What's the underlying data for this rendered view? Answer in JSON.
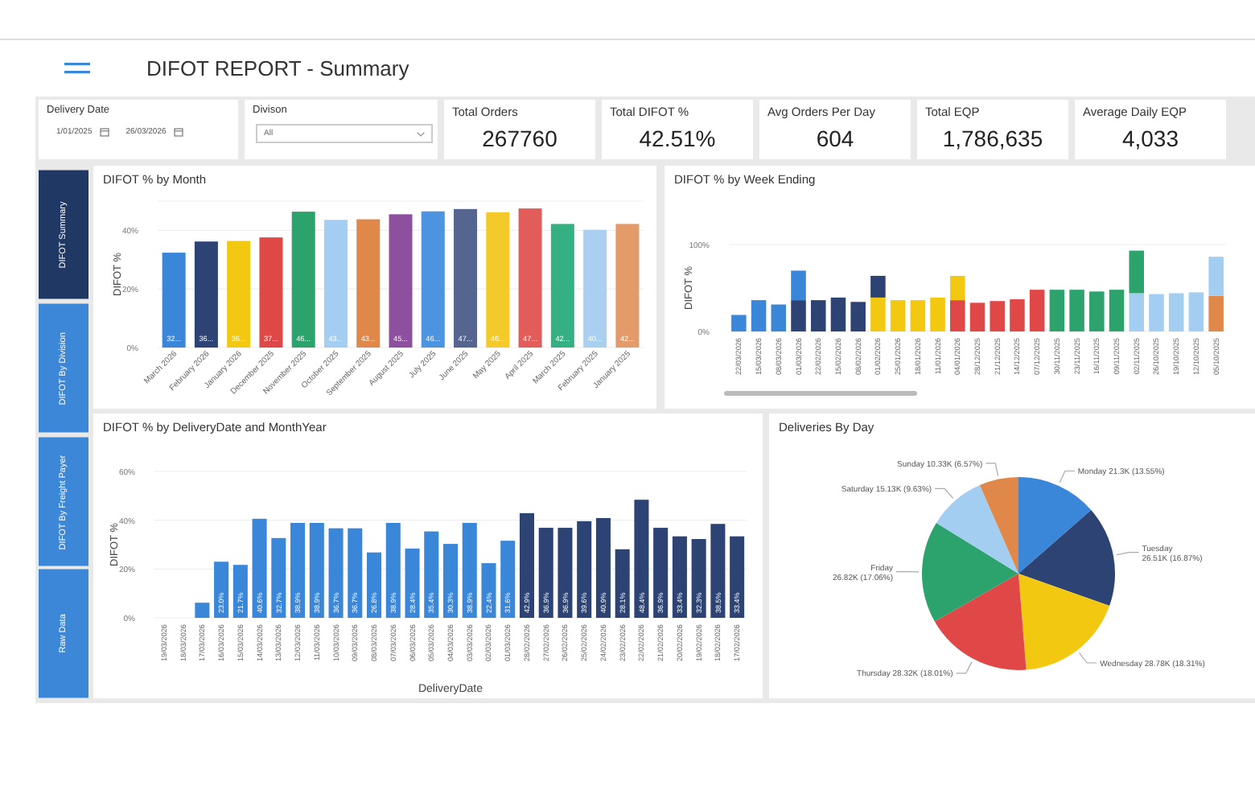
{
  "header": {
    "title": "DIFOT REPORT - Summary"
  },
  "filters": [
    {
      "kind": "date_range",
      "label": "Delivery Date",
      "from": "1/01/2025",
      "to": "26/03/2026"
    },
    {
      "kind": "dropdown",
      "label": "Divison",
      "value": "All"
    }
  ],
  "kpis": [
    {
      "label": "Total Orders",
      "value": "267760"
    },
    {
      "label": "Total DIFOT %",
      "value": "42.51%"
    },
    {
      "label": "Avg Orders Per Day",
      "value": "604"
    },
    {
      "label": "Total EQP",
      "value": "1,786,635"
    },
    {
      "label": "Average Daily EQP",
      "value": "4,033"
    }
  ],
  "tabs": [
    {
      "label": "DIFOT Summary",
      "selected": true
    },
    {
      "label": "DIFOT By Division",
      "selected": false
    },
    {
      "label": "DIFOT By Freight Payer",
      "selected": false
    },
    {
      "label": "Raw Data",
      "selected": false
    }
  ],
  "charts": [
    {
      "chart_data": {
        "type": "bar",
        "title": "DIFOT % by Month",
        "ylabel": "DIFOT %",
        "categories": [
          "March 2026",
          "February 2026",
          "January 2026",
          "December 2025",
          "November 2025",
          "October 2025",
          "September 2025",
          "August 2025",
          "July 2025",
          "June 2025",
          "May 2025",
          "April 2025",
          "March 2025",
          "February 2025",
          "January 2025"
        ],
        "series": [
          {
            "colors": [
              "#3a86d8",
              "#2d4373",
              "#f2c811",
              "#e04848",
              "#2ca36d",
              "#a4cdf2",
              "#e0874a",
              "#8e4f9f",
              "#4c94e0",
              "#56658f",
              "#f3ca2a",
              "#e25c5a",
              "#35b083",
              "#a9d0f0",
              "#e49b69"
            ],
            "values": [
              32.4,
              36.2,
              36.4,
              37.6,
              46.4,
              43.6,
              43.8,
              45.5,
              46.5,
              47.3,
              46.2,
              47.5,
              42.2,
              40.2,
              42.2
            ]
          }
        ],
        "ylim": [
          0,
          50
        ],
        "yticks": [
          {
            "value": 0,
            "label": "0%"
          },
          {
            "value": 20,
            "label": "20%"
          },
          {
            "value": 40,
            "label": "40%"
          }
        ],
        "value_labels": [
          "32...",
          "36...",
          "36...",
          "37...",
          "46...",
          "43...",
          "43...",
          "45...",
          "46...",
          "47...",
          "46...",
          "47...",
          "42...",
          "40...",
          "42..."
        ]
      }
    },
    {
      "chart_data": {
        "type": "bar",
        "title": "DIFOT % by Week Ending",
        "ylabel": "DIFOT %",
        "stacked": true,
        "categories": [
          "22/03/2026",
          "15/03/2026",
          "08/03/2026",
          "01/03/2026",
          "22/02/2026",
          "15/02/2026",
          "08/02/2026",
          "01/02/2026",
          "25/01/2026",
          "18/01/2026",
          "11/01/2026",
          "04/01/2026",
          "28/12/2025",
          "21/12/2025",
          "14/12/2025",
          "07/12/2025",
          "30/11/2025",
          "23/11/2025",
          "16/11/2025",
          "09/11/2025",
          "02/11/2025",
          "26/10/2025",
          "19/10/2025",
          "12/10/2025",
          "05/10/2025"
        ],
        "series": [
          {
            "color": "#e0874a",
            "values": [
              null,
              null,
              null,
              null,
              null,
              null,
              null,
              null,
              null,
              null,
              null,
              null,
              null,
              null,
              null,
              null,
              null,
              null,
              null,
              null,
              null,
              null,
              null,
              null,
              41
            ]
          },
          {
            "color": "#a4cdf2",
            "values": [
              null,
              null,
              null,
              null,
              null,
              null,
              null,
              null,
              null,
              null,
              null,
              null,
              null,
              null,
              null,
              null,
              null,
              null,
              null,
              null,
              44,
              43,
              44,
              45,
              45
            ]
          },
          {
            "color": "#2ca36d",
            "values": [
              null,
              null,
              null,
              null,
              null,
              null,
              null,
              null,
              null,
              null,
              null,
              null,
              null,
              null,
              null,
              null,
              48,
              48,
              46,
              48,
              49,
              null,
              null,
              null,
              null
            ]
          },
          {
            "color": "#e04848",
            "values": [
              null,
              null,
              null,
              null,
              null,
              null,
              null,
              null,
              null,
              null,
              null,
              36,
              33,
              35,
              37,
              48,
              null,
              null,
              null,
              null,
              null,
              null,
              null,
              null,
              null
            ]
          },
          {
            "color": "#f2c811",
            "values": [
              null,
              null,
              null,
              null,
              null,
              null,
              null,
              39,
              36,
              36,
              39,
              28,
              null,
              null,
              null,
              null,
              null,
              null,
              null,
              null,
              null,
              null,
              null,
              null,
              null
            ]
          },
          {
            "color": "#2d4373",
            "values": [
              null,
              null,
              null,
              36,
              36,
              39,
              34,
              25,
              null,
              null,
              null,
              null,
              null,
              null,
              null,
              null,
              null,
              null,
              null,
              null,
              null,
              null,
              null,
              null,
              null
            ]
          },
          {
            "color": "#3a86d8",
            "values": [
              19,
              36,
              31,
              34,
              null,
              null,
              null,
              null,
              null,
              null,
              null,
              null,
              null,
              null,
              null,
              null,
              null,
              null,
              null,
              null,
              null,
              null,
              null,
              null,
              null
            ]
          }
        ],
        "ylim": [
          0,
          100
        ],
        "yticks": [
          {
            "value": 0,
            "label": "0%"
          },
          {
            "value": 100,
            "label": "100%"
          }
        ]
      }
    },
    {
      "chart_data": {
        "type": "bar",
        "title": "DIFOT % by DeliveryDate and MonthYear",
        "xlabel": "DeliveryDate",
        "ylabel": "DIFOT %",
        "stacked": true,
        "categories": [
          "19/03/2026",
          "18/03/2026",
          "17/03/2026",
          "16/03/2026",
          "15/03/2026",
          "14/03/2026",
          "13/03/2026",
          "12/03/2026",
          "11/03/2026",
          "10/03/2026",
          "09/03/2026",
          "08/03/2026",
          "07/03/2026",
          "06/03/2026",
          "05/03/2026",
          "04/03/2026",
          "03/03/2026",
          "02/03/2026",
          "01/03/2026",
          "28/02/2026",
          "27/02/2026",
          "26/02/2026",
          "25/02/2026",
          "24/02/2026",
          "23/02/2026",
          "22/02/2026",
          "21/02/2026",
          "20/02/2026",
          "19/02/2026",
          "18/02/2026",
          "17/02/2026"
        ],
        "series": [
          {
            "color": "#3a86d8",
            "values": [
              null,
              null,
              6.2,
              23.0,
              21.7,
              40.6,
              32.7,
              38.9,
              38.9,
              36.7,
              36.7,
              26.8,
              38.9,
              28.4,
              35.4,
              30.3,
              38.9,
              22.4,
              31.6,
              null,
              null,
              null,
              null,
              null,
              null,
              null,
              null,
              null,
              null,
              null,
              null
            ]
          },
          {
            "color": "#2d4373",
            "values": [
              null,
              null,
              null,
              null,
              null,
              null,
              null,
              null,
              null,
              null,
              null,
              null,
              null,
              null,
              null,
              null,
              null,
              null,
              null,
              42.9,
              36.9,
              36.9,
              39.6,
              40.9,
              28.1,
              48.4,
              36.9,
              33.4,
              32.3,
              38.5,
              33.4
            ]
          }
        ],
        "value_labels": [
          null,
          null,
          null,
          "23.0%",
          "21.7%",
          "40.6%",
          "32.7%",
          "38.9%",
          "38.9%",
          "36.7%",
          "36.7%",
          "26.8%",
          "38.9%",
          "28.4%",
          "35.4%",
          "30.3%",
          "38.9%",
          "22.4%",
          "31.6%",
          "42.9%",
          "36.9%",
          "36.9%",
          "39.6%",
          "40.9%",
          "28.1%",
          "48.4%",
          "36.9%",
          "33.4%",
          "32.3%",
          "38.5%",
          "33.4%"
        ],
        "ylim": [
          0,
          60
        ],
        "yticks": [
          {
            "value": 0,
            "label": "0%"
          },
          {
            "value": 20,
            "label": "20%"
          },
          {
            "value": 40,
            "label": "40%"
          },
          {
            "value": 60,
            "label": "60%"
          }
        ]
      }
    },
    {
      "chart_data": {
        "type": "pie",
        "title": "Deliveries By Day",
        "categories": [
          "Monday",
          "Tuesday",
          "Wednesday",
          "Thursday",
          "Friday",
          "Saturday",
          "Sunday"
        ],
        "series": [
          {
            "colors": [
              "#3a86d8",
              "#2d4373",
              "#f2c811",
              "#e04848",
              "#2ca36d",
              "#a4cdf2",
              "#e0874a"
            ],
            "values": [
              13.55,
              16.87,
              18.31,
              18.01,
              17.06,
              9.63,
              6.57
            ]
          }
        ],
        "value_labels": [
          "21.3K (13.55%)",
          "26.51K (16.87%)",
          "28.78K (18.31%)",
          "28.32K (18.01%)",
          "26.82K (17.06%)",
          "15.13K (9.63%)",
          "10.33K (6.57%)"
        ]
      }
    }
  ]
}
